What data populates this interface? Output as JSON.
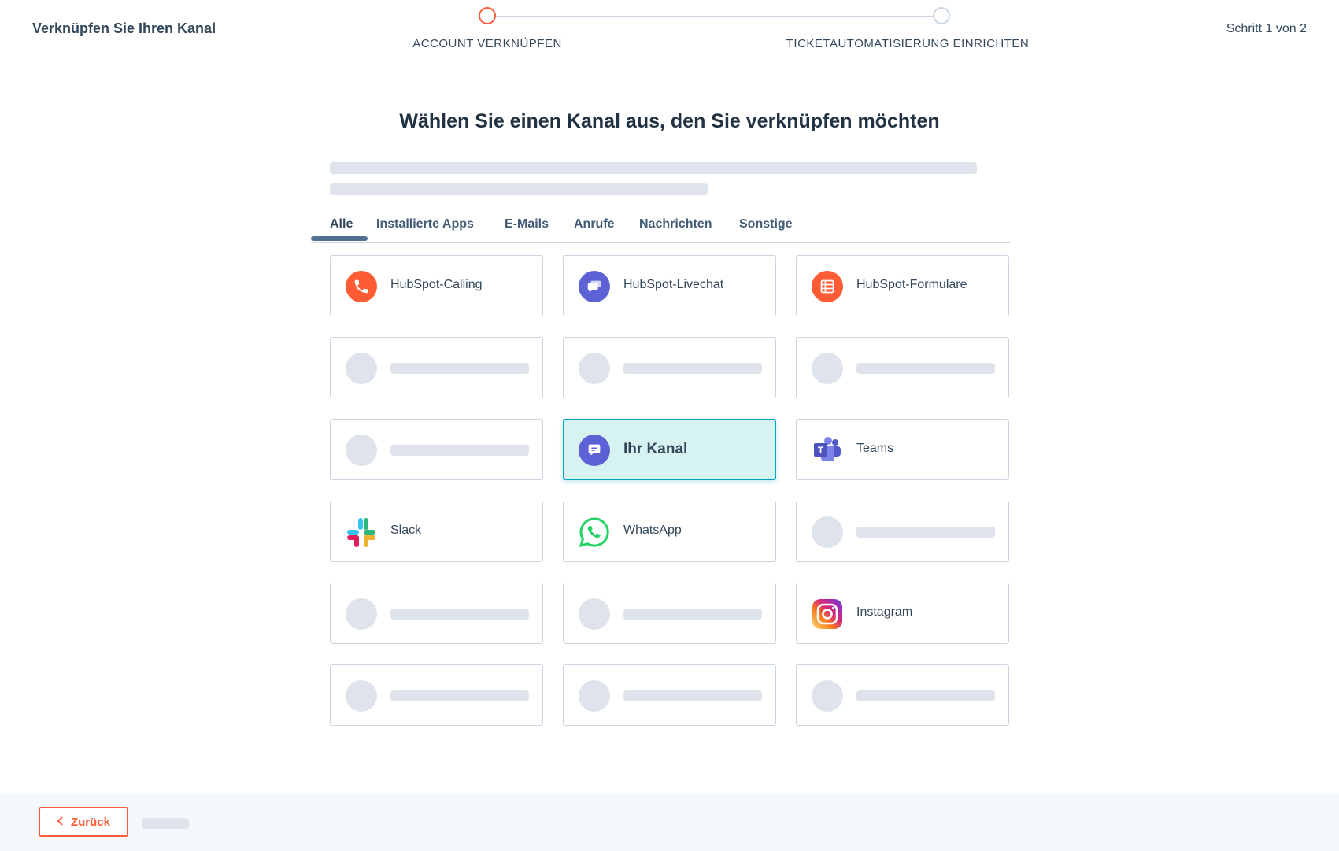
{
  "header": {
    "title": "Verknüpfen Sie Ihren Kanal",
    "step_count": "Schritt 1 von 2",
    "steps": [
      {
        "label": "ACCOUNT VERKNÜPFEN",
        "active": true
      },
      {
        "label": "TICKETAUTOMATISIERUNG EINRICHTEN",
        "active": false
      }
    ]
  },
  "main": {
    "title": "Wählen Sie einen Kanal aus, den Sie verknüpfen möchten",
    "tabs": [
      {
        "label": "Alle",
        "active": true
      },
      {
        "label": "Installierte Apps"
      },
      {
        "label": "E-Mails"
      },
      {
        "label": "Anrufe"
      },
      {
        "label": "Nachrichten"
      },
      {
        "label": "Sonstige"
      }
    ],
    "channels": [
      {
        "label": "HubSpot-Calling",
        "icon": "phone-icon",
        "color": "#ff5c35"
      },
      {
        "label": "HubSpot-Livechat",
        "icon": "chat-bubbles-icon",
        "color": "#5c62d6"
      },
      {
        "label": "HubSpot-Formulare",
        "icon": "form-icon",
        "color": "#ff5c35"
      },
      {
        "label": "Ihr Kanal",
        "icon": "chat-bubble-icon",
        "color": "#5c62d6",
        "selected": true
      },
      {
        "label": "Teams",
        "icon": "teams-logo-icon",
        "color": "#5059c9"
      },
      {
        "label": "Slack",
        "icon": "slack-logo-icon"
      },
      {
        "label": "WhatsApp",
        "icon": "whatsapp-logo-icon",
        "color": "#25d366"
      },
      {
        "label": "Instagram",
        "icon": "instagram-logo-icon"
      }
    ]
  },
  "footer": {
    "back_label": "Zurück",
    "back_icon": "chevron-left-icon"
  },
  "colors": {
    "accent": "#ff5c35",
    "selected_bg": "#d6f3f2",
    "selected_border": "#00a4bd",
    "skeleton": "#dfe3eb"
  }
}
